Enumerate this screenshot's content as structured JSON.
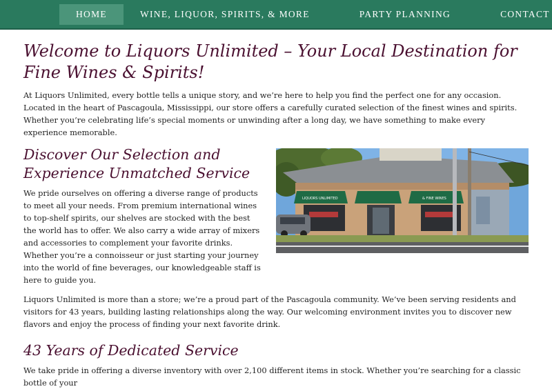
{
  "nav": {
    "items": [
      {
        "label": "HOME"
      },
      {
        "label": "WINE, LIQUOR, SPIRITS, & MORE"
      },
      {
        "label": "PARTY PLANNING"
      },
      {
        "label": "CONTACT"
      }
    ]
  },
  "main": {
    "title": "Welcome to Liquors Unlimited – Your Local Destination for Fine Wines & Spirits!",
    "intro": "At Liquors Unlimited, every bottle tells a unique story, and we’re here to help you find the perfect one for any occasion. Located in the heart of Pascagoula, Mississippi, our store offers a carefully curated selection of the finest wines and spirits. Whether you’re celebrating life’s special moments or unwinding after a long day, we have something to make every experience memorable.",
    "section1": {
      "heading": "Discover Our Selection and Experience Unmatched Service",
      "body": "We pride ourselves on offering a diverse range of products to meet all your needs. From premium international wines to top-shelf spirits, our shelves are stocked with the best the world has to offer. We also carry a wide array of mixers and accessories to complement your favorite drinks. Whether you’re a connoisseur or just starting your journey into the world of fine beverages, our knowledgeable staff is here to guide you."
    },
    "community": "Liquors Unlimited is more than a store; we’re a proud part of the Pascagoula community. We’ve been serving residents and visitors for 43 years, building lasting relationships along the way. Our welcoming environment invites you to discover new flavors and enjoy the process of finding your next favorite drink.",
    "section2": {
      "heading": "43 Years of Dedicated Service",
      "body": "We take pride in offering a diverse inventory with over 2,100 different items in stock. Whether you’re searching for a classic bottle of your"
    },
    "photo": {
      "sign_text": "LIQUORS UNLIMITED",
      "sign_text_right": "& FINE WINES"
    }
  }
}
